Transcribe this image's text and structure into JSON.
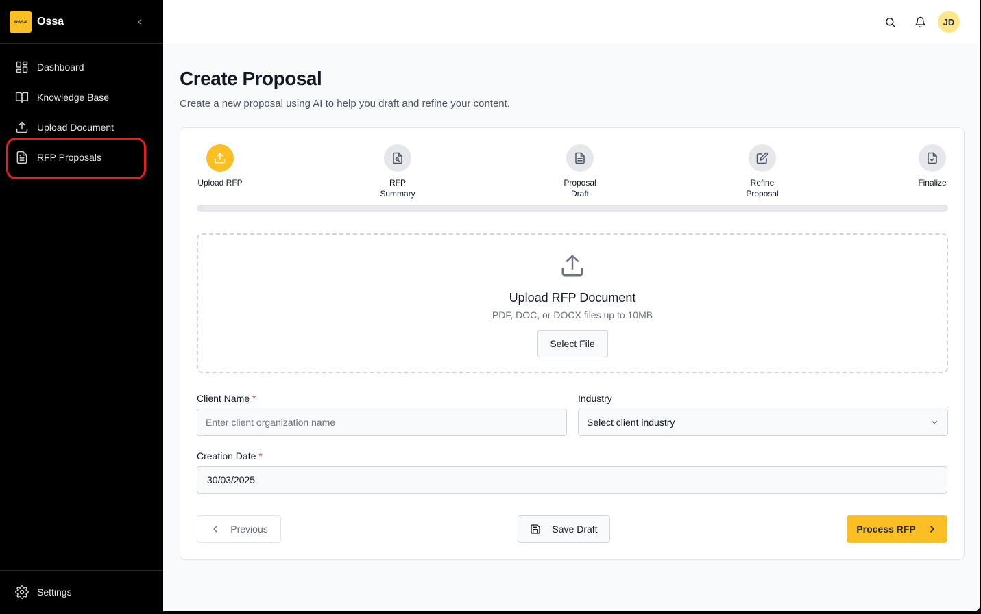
{
  "brand": {
    "logo_text": "ossa",
    "name": "Ossa"
  },
  "sidebar": {
    "items": [
      {
        "label": "Dashboard",
        "icon": "dashboard-icon"
      },
      {
        "label": "Knowledge Base",
        "icon": "book-icon"
      },
      {
        "label": "Upload Document",
        "icon": "upload-icon"
      },
      {
        "label": "RFP Proposals",
        "icon": "document-icon"
      }
    ],
    "highlighted_item": "RFP Proposals",
    "settings_label": "Settings"
  },
  "topbar": {
    "avatar_initials": "JD"
  },
  "page": {
    "title": "Create Proposal",
    "subtitle": "Create a new proposal using AI to help you draft and refine your content."
  },
  "steps": [
    {
      "label": "Upload RFP",
      "active": true
    },
    {
      "label": "RFP\nSummary",
      "active": false
    },
    {
      "label": "Proposal\nDraft",
      "active": false
    },
    {
      "label": "Refine\nProposal",
      "active": false
    },
    {
      "label": "Finalize",
      "active": false
    }
  ],
  "progress": {
    "value": 0
  },
  "upload": {
    "title": "Upload RFP Document",
    "subtitle": "PDF, DOC, or DOCX files up to 10MB",
    "button_label": "Select File"
  },
  "form": {
    "client_name": {
      "label": "Client Name",
      "required_mark": "*",
      "placeholder": "Enter client organization name",
      "value": ""
    },
    "industry": {
      "label": "Industry",
      "selected": "Select client industry"
    },
    "creation_date": {
      "label": "Creation Date",
      "required_mark": "*",
      "value": "30/03/2025"
    }
  },
  "actions": {
    "previous_label": "Previous",
    "save_label": "Save Draft",
    "process_label": "Process RFP"
  },
  "colors": {
    "accent": "#fbbf24",
    "highlight": "#ef1c1c",
    "sidebar_bg": "#000000"
  }
}
